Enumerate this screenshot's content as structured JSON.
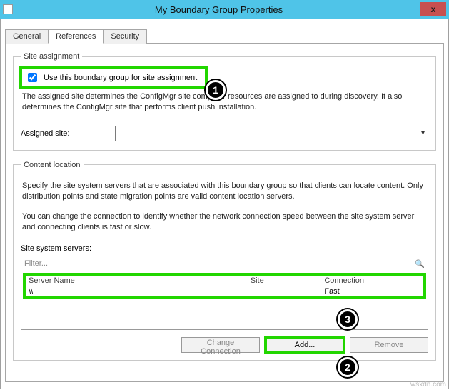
{
  "window": {
    "title": "My Boundary Group Properties",
    "close_x": "x"
  },
  "tabs": {
    "general": "General",
    "references": "References",
    "security": "Security"
  },
  "site_assignment": {
    "legend": "Site assignment",
    "checkbox_label": "Use this boundary group for site assignment",
    "checked": true,
    "description": "The assigned site determines the ConfigMgr site computer resources are assigned to during discovery. It also determines the ConfigMgr site that performs client push installation.",
    "assigned_site_label": "Assigned site:",
    "assigned_site_value": ""
  },
  "content_location": {
    "legend": "Content location",
    "description1": "Specify the site system servers that are associated with this boundary group so that clients can locate content. Only distribution points and state migration points are valid content location servers.",
    "description2": "You can change the connection to identify whether the network connection speed between the site system server and connecting clients is fast or slow.",
    "servers_label": "Site system servers:",
    "filter_placeholder": "Filter...",
    "columns": {
      "name": "Server Name",
      "site": "Site",
      "conn": "Connection"
    },
    "rows": [
      {
        "name": "\\\\",
        "site": "",
        "conn": "Fast"
      }
    ],
    "buttons": {
      "change_connection": "Change Connection",
      "add": "Add...",
      "remove": "Remove"
    }
  },
  "annotations": {
    "a1": "1",
    "a2": "2",
    "a3": "3"
  },
  "watermark": "wsxdn.com"
}
